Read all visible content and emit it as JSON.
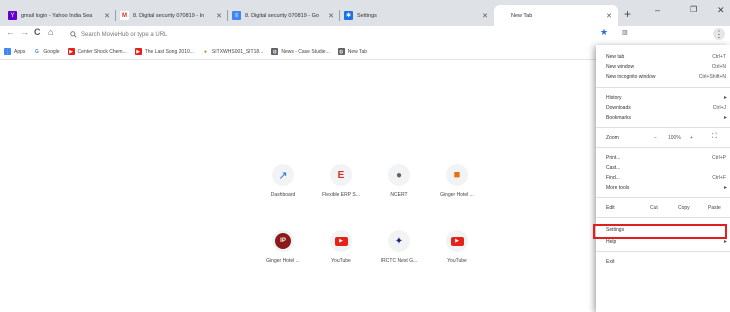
{
  "tabs": [
    {
      "title": "gmail login - Yahoo India Sea",
      "icon": "yahoo-icon",
      "color": "#6001d2"
    },
    {
      "title": "8. Digital security 070819 - In",
      "icon": "gmail-icon",
      "color": "#d93025"
    },
    {
      "title": "8. Digital security 070819 - Go",
      "icon": "docs-icon",
      "color": "#4285f4"
    },
    {
      "title": "Settings",
      "icon": "gear-icon",
      "color": "#1a73e8"
    },
    {
      "title": "New Tab",
      "icon": "newtab-icon",
      "color": ""
    }
  ],
  "toolbar": {
    "back": "←",
    "forward": "→",
    "reload": "C",
    "home": "⌂",
    "omnibox_placeholder": "Search MovieHub or type a URL"
  },
  "bookmarks": [
    {
      "label": "Apps",
      "icon": "apps-icon",
      "color": "#4285f4"
    },
    {
      "label": "Google",
      "icon": "google-icon",
      "color": "#4285f4"
    },
    {
      "label": "Center Shock Chem...",
      "icon": "youtube-icon",
      "color": "#e62117"
    },
    {
      "label": "The Last Song 2010...",
      "icon": "youtube-icon",
      "color": "#e62117"
    },
    {
      "label": "SITXWHS001_SIT18...",
      "icon": "site-icon",
      "color": "#c48a00"
    },
    {
      "label": "News - Case Studie...",
      "icon": "globe-icon",
      "color": "#5f6368"
    },
    {
      "label": "New Tab",
      "icon": "globe-icon",
      "color": "#5f6368"
    }
  ],
  "shortcuts": [
    {
      "label": "Dashboard",
      "icon": "chart-icon",
      "glyph": "↗",
      "color": "#1a73e8"
    },
    {
      "label": "Flexible ERP S...",
      "icon": "erp-icon",
      "glyph": "E",
      "color": "#d93025"
    },
    {
      "label": "NCERT",
      "icon": "ncert-icon",
      "glyph": "●",
      "color": "#5f6368"
    },
    {
      "label": "Ginger Hotel ...",
      "icon": "hotel-icon",
      "glyph": "■",
      "color": "#e8710a"
    },
    {
      "label": "Ginger Hotel ...",
      "icon": "ip-icon",
      "glyph": "IP",
      "color": "#8b1a1a"
    },
    {
      "label": "YouTube",
      "icon": "youtube-icon",
      "glyph": "▶",
      "color": "#e62117"
    },
    {
      "label": "IRCTC Next G...",
      "icon": "irctc-icon",
      "glyph": "✦",
      "color": "#1a237e"
    },
    {
      "label": "YouTube",
      "icon": "youtube-icon",
      "glyph": "▶",
      "color": "#e62117"
    }
  ],
  "menu": {
    "new_tab": "New tab",
    "new_tab_sc": "Ctrl+T",
    "new_window": "New window",
    "new_window_sc": "Ctrl+N",
    "incognito": "New incognito window",
    "incognito_sc": "Ctrl+Shift+N",
    "history": "History",
    "downloads": "Downloads",
    "downloads_sc": "Ctrl+J",
    "bookmarks": "Bookmarks",
    "zoom": "Zoom",
    "zoom_minus": "−",
    "zoom_level": "100%",
    "zoom_plus": "+",
    "fullscreen": "⛶",
    "print": "Print...",
    "print_sc": "Ctrl+P",
    "cast": "Cast...",
    "find": "Find...",
    "find_sc": "Ctrl+F",
    "more_tools": "More tools",
    "edit": "Edit",
    "cut": "Cut",
    "copy": "Copy",
    "paste": "Paste",
    "settings": "Settings",
    "help": "Help",
    "exit": "Exit",
    "arrow": "▸"
  },
  "highlight_color": "#e02020"
}
